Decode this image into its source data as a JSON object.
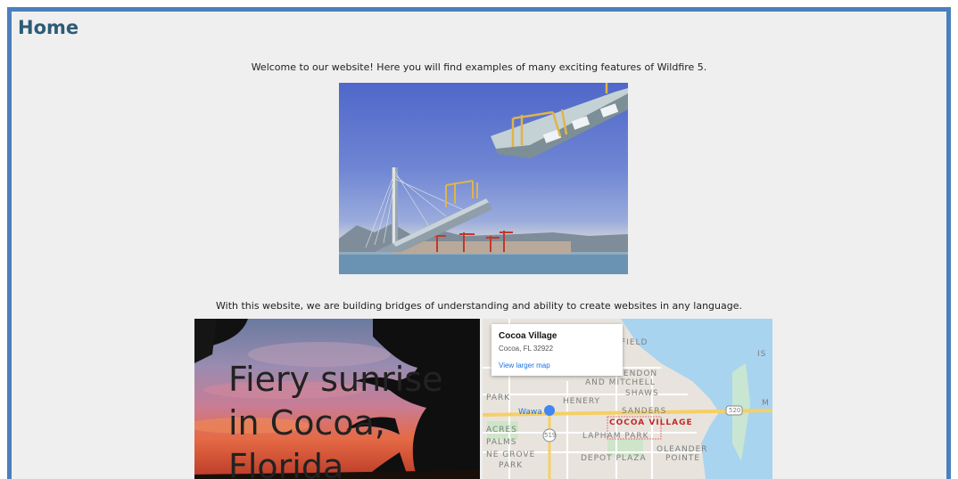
{
  "page": {
    "title": "Home",
    "intro": "Welcome to our website! Here you will find examples of many exciting features of Wildfire 5.",
    "caption": "With this website, we are building bridges of understanding and ability to create websites in any language."
  },
  "images": {
    "bridge_alt": "Cable-stayed bridge under construction",
    "sunrise_text": "Fiery sunrise\nin Cocoa,\nFlorida"
  },
  "map": {
    "popup": {
      "title": "Cocoa Village",
      "address": "Cocoa, FL 32922",
      "link": "View larger map"
    },
    "labels": {
      "field": "FIELD",
      "is": "IS",
      "endon": "ENDON",
      "and_mitchell": "AND MITCHELL",
      "shaws": "SHAWS",
      "park": "PARK",
      "henery": "HENERY",
      "m": "M",
      "wawa": "Wawa",
      "sanders": "SANDERS",
      "route_520": "520",
      "cocoa_village": "COCOA VILLAGE",
      "acres": "ACRES",
      "route_519": "519",
      "lapham_park": "LAPHAM PARK",
      "palms": "PALMS",
      "oleander": "OLEANDER",
      "ne_grove": "NE GROVE",
      "depot_plaza": "DEPOT PLAZA",
      "pointe": "POINTE",
      "park2": "PARK"
    }
  },
  "colors": {
    "frame_border": "#4b7fbd",
    "title": "#2c5c78",
    "water": "#a8d4f0",
    "link": "#1a73e8"
  }
}
